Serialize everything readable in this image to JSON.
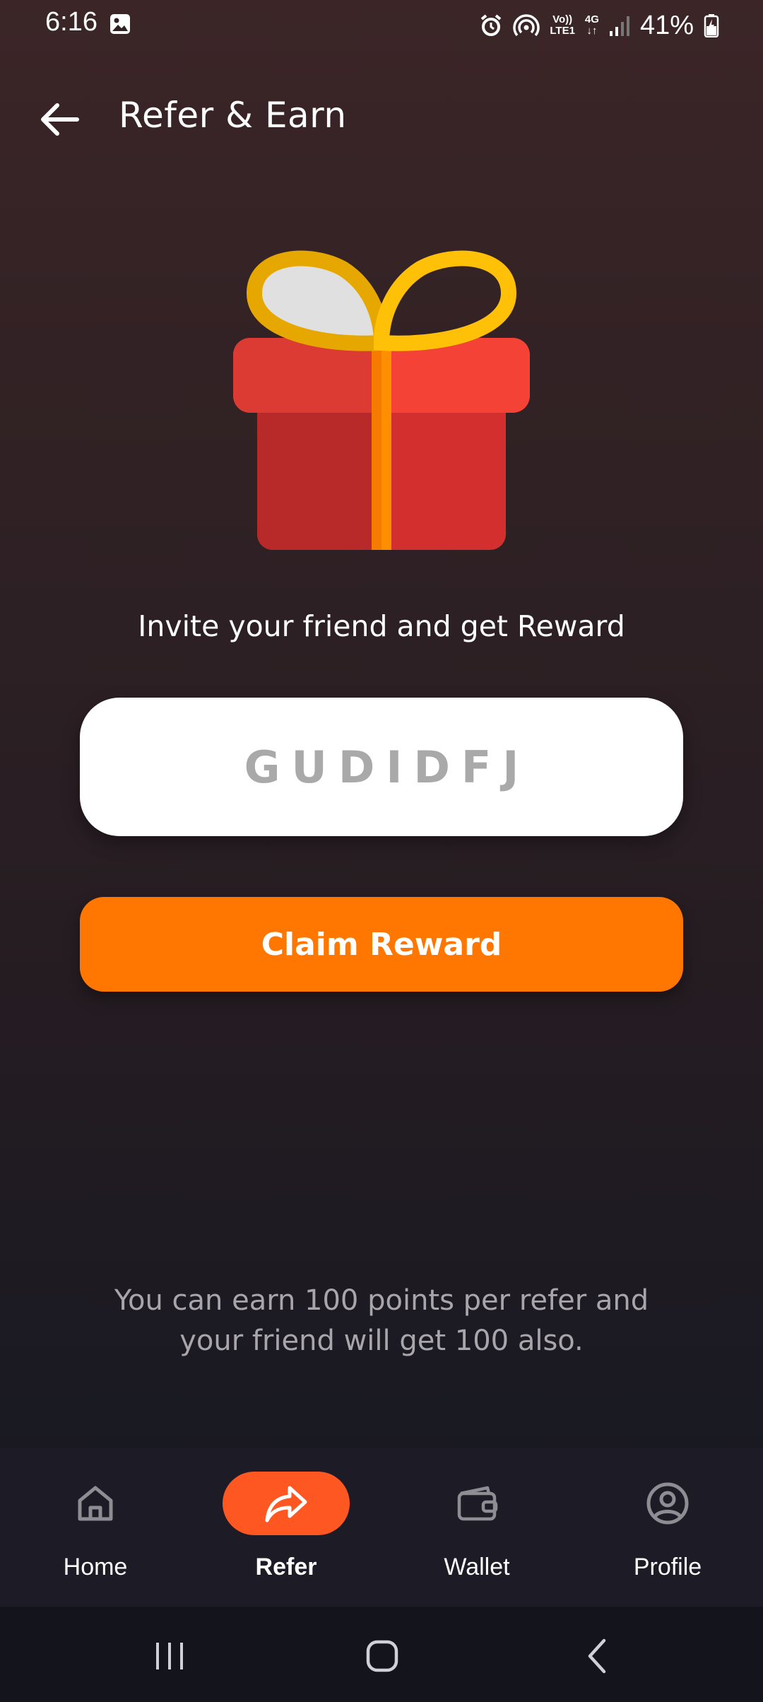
{
  "status_bar": {
    "time": "6:16",
    "network_top": "Vo))",
    "network_bottom": "LTE1",
    "data_top": "4G",
    "data_bottom": "↓↑",
    "battery": "41%"
  },
  "header": {
    "title": "Refer & Earn"
  },
  "main": {
    "invite_text": "Invite your friend and get Reward",
    "referral_code": "GUDIDFJ",
    "claim_button": "Claim Reward",
    "info_text": "You can earn 100 points per refer and your friend will get 100 also."
  },
  "bottom_nav": {
    "items": [
      {
        "label": "Home",
        "icon": "home-icon",
        "active": false
      },
      {
        "label": "Refer",
        "icon": "share-icon",
        "active": true
      },
      {
        "label": "Wallet",
        "icon": "wallet-icon",
        "active": false
      },
      {
        "label": "Profile",
        "icon": "profile-icon",
        "active": false
      }
    ]
  },
  "colors": {
    "accent": "#ff7700",
    "nav_active": "#ff5722",
    "code_text": "#a9a9a9"
  }
}
